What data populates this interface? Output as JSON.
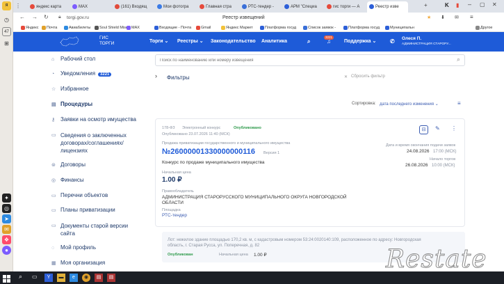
{
  "rail": {
    "badge": "47"
  },
  "tabs": [
    {
      "label": "яндекс карта",
      "color": "#e64a3b"
    },
    {
      "label": "MAX",
      "color": "#7c5cff"
    },
    {
      "label": "(161) Входящ",
      "color": "#e14b3b"
    },
    {
      "label": "Мои фотогра",
      "color": "#3b7be6"
    },
    {
      "label": "Главная стра",
      "color": "#e64a3b"
    },
    {
      "label": "РТС-тендер -",
      "color": "#3a6fd8"
    },
    {
      "label": "АРМ \"Специа",
      "color": "#2d5fd8"
    },
    {
      "label": "гис торги — А",
      "color": "#e64a3b"
    },
    {
      "label": "Реестр изве",
      "color": "#2d5fd8"
    }
  ],
  "address": {
    "url": "torgi.gov.ru",
    "page_title": "Реестр извещений"
  },
  "bookmarks": [
    {
      "label": "Яндекс",
      "color": "#e64a3b"
    },
    {
      "label": "Почта",
      "color": "#e0a12a"
    },
    {
      "label": "Авиабилеты",
      "color": "#2d8ae0"
    },
    {
      "label": "Soul Shield Miser",
      "color": "#555"
    },
    {
      "label": "MAX",
      "color": "#7c5cff"
    },
    {
      "label": "Входящие - Почта",
      "color": "#2d5fd8"
    },
    {
      "label": "Gmail",
      "color": "#e64a3b"
    },
    {
      "label": "Яндекс Маркет",
      "color": "#f2c23a"
    },
    {
      "label": "Платформа госуд",
      "color": "#2d5fd8"
    },
    {
      "label": "Список заявок -",
      "color": "#3a6fd8"
    },
    {
      "label": "Платформа госуд",
      "color": "#2d5fd8"
    },
    {
      "label": "Муниципальн",
      "color": "#2d5fd8"
    },
    {
      "label": "Другое",
      "color": "#888"
    }
  ],
  "site": {
    "logo_top": "ГИС",
    "logo_bottom": "ТОРГИ",
    "nav": [
      "Торги ⌄",
      "Реестры ⌄",
      "Законодательство",
      "Аналитика"
    ],
    "notif_count": "3221",
    "support": "Поддержка ⌄",
    "user_name": "Олеся П.",
    "user_org": "АДМИНИСТРАЦИЯ СТАРОРУ..."
  },
  "sidebar": [
    {
      "label": "Рабочий стол",
      "icon": "home-icon",
      "glyph": "⌂"
    },
    {
      "label": "Уведомления",
      "icon": "bell-icon",
      "glyph": "◔",
      "badge": "3221"
    },
    {
      "label": "Избранное",
      "icon": "star-icon",
      "glyph": "☆"
    },
    {
      "label": "Процедуры",
      "icon": "doc-icon",
      "glyph": "▤",
      "active": true
    },
    {
      "label": "Заявки на осмотр имущества",
      "icon": "key-icon",
      "glyph": "⚷"
    },
    {
      "label": "Сведения о заключенных договорах/соглашениях/лицензиях",
      "icon": "file-icon",
      "glyph": "▭"
    },
    {
      "label": "Договоры",
      "icon": "handshake-icon",
      "glyph": "⊜"
    },
    {
      "label": "Финансы",
      "icon": "money-icon",
      "glyph": "◎"
    },
    {
      "label": "Перечни объектов",
      "icon": "list-icon",
      "glyph": "▭"
    },
    {
      "label": "Планы приватизации",
      "icon": "plan-icon",
      "glyph": "▭"
    },
    {
      "label": "Документы старой версии сайта",
      "icon": "archive-icon",
      "glyph": "▭"
    },
    {
      "label": "Мой профиль",
      "icon": "user-icon",
      "glyph": "◌"
    },
    {
      "label": "Моя организация",
      "icon": "org-icon",
      "glyph": "▦"
    }
  ],
  "search": {
    "placeholder": "Поиск по наименованию или номеру извещения"
  },
  "filters": {
    "title": "Фильтры",
    "reset": "Сбросить фильтр"
  },
  "sort": {
    "label": "Сортировка:",
    "value": "дата последнего изменения ⌄"
  },
  "card": {
    "code": "178-ФЗ",
    "type": "Электронный конкурс",
    "status": "Опубликовано",
    "published": "Опубликовано 23.07.2026 11:40 (МСК)",
    "subtitle": "Продажа приватизации государственного и муниципального имущества",
    "number": "№26000001330000000116",
    "version": "Версия 1",
    "name": "Конкурс по продаже муниципального имущества",
    "deadline_label": "Дата и время окончания подачи заявок",
    "deadline_date": "24.08.2026",
    "deadline_time": "17:00 (МСК)",
    "start_label": "Начало торгов",
    "start_date": "26.08.2026",
    "start_time": "10:00 (МСК)",
    "price_label": "Начальная цена",
    "price": "1.00 ₽",
    "owner_label": "Правообладатель",
    "owner": "АДМИНИСТРАЦИЯ СТАРОРУССКОГО МУНИЦИПАЛЬНОГО ОКРУГА НОВГОРОДСКОЙ ОБЛАСТИ",
    "platform_label": "Площадка",
    "platform": "РТС-тендер"
  },
  "lot": {
    "text": "Лот: нежилое здание площадью 170,2 кв. м, с кадастровым номером 53:24:0020140:109, расположенное по адресу: Новгородская область, г. Старая Русса, ул. Поперечная, д. 82",
    "status": "Опубликован",
    "price_label": "Начальная цена",
    "price": "1.00 ₽"
  },
  "watermark": "Restate"
}
